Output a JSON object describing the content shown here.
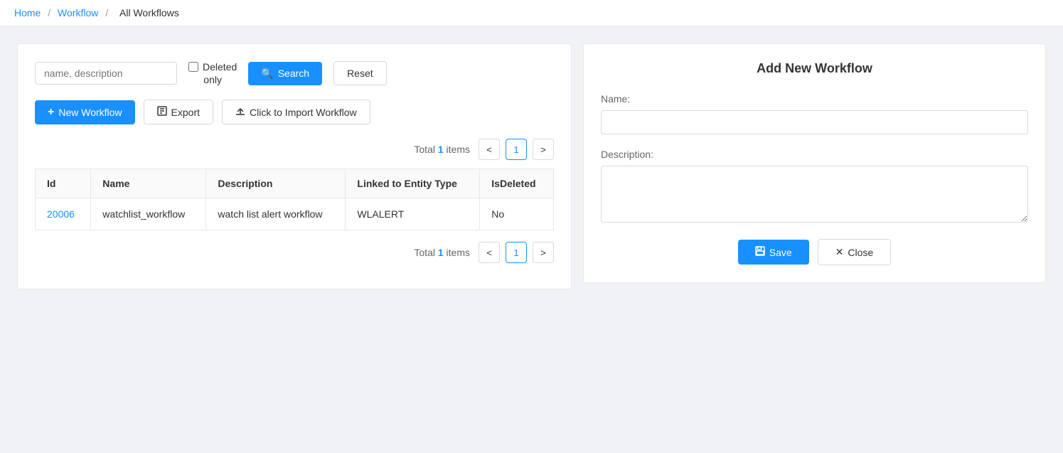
{
  "breadcrumb": {
    "home": "Home",
    "workflow": "Workflow",
    "current": "All Workflows",
    "sep": "/"
  },
  "search": {
    "placeholder": "name, description",
    "checkbox_label_line1": "Deleted",
    "checkbox_label_line2": "only",
    "search_btn": "Search",
    "reset_btn": "Reset"
  },
  "actions": {
    "new_workflow": "New Workflow",
    "export": "Export",
    "import": "Click to Import Workflow"
  },
  "pagination": {
    "total_prefix": "Total ",
    "total_count": "1",
    "total_suffix": " items",
    "current_page": "1"
  },
  "table": {
    "columns": [
      "Id",
      "Name",
      "Description",
      "Linked to Entity Type",
      "IsDeleted"
    ],
    "rows": [
      {
        "id": "20006",
        "name": "watchlist_workflow",
        "description": "watch list alert workflow",
        "linked_entity": "WLALERT",
        "is_deleted": "No"
      }
    ]
  },
  "right_panel": {
    "title": "Add New Workflow",
    "name_label": "Name:",
    "description_label": "Description:",
    "save_btn": "Save",
    "close_btn": "Close"
  },
  "icons": {
    "search": "🔍",
    "plus": "+",
    "export_icon": "⊟",
    "upload_icon": "⬆",
    "save_icon": "💾",
    "close_icon": "✕",
    "prev_icon": "<",
    "next_icon": ">"
  }
}
